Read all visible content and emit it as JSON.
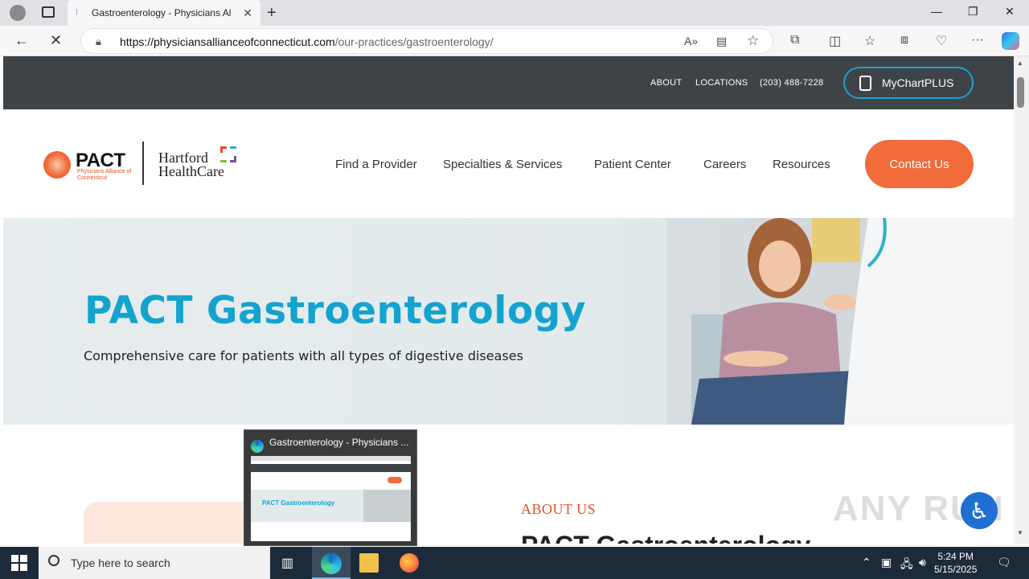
{
  "browser": {
    "tab_title": "Gastroenterology - Physicians Al",
    "url_domain": "https://physiciansallianceofconnecticut.com",
    "url_path": "/our-practices/gastroenterology/"
  },
  "site": {
    "top_links": [
      "ABOUT",
      "LOCATIONS",
      "(203) 488-7228"
    ],
    "mychart_label": "MyChartPLUS",
    "logo_pact": "PACT",
    "logo_sub": "Physicians Alliance of Connecticut",
    "logo_hhc": [
      "Hartford",
      "HealthCare"
    ],
    "nav": [
      "Find a Provider",
      "Specialties & Services",
      "Patient Center",
      "Careers",
      "Resources"
    ],
    "contact_label": "Contact Us",
    "hero_title": "PACT Gastroenterology",
    "hero_subtitle": "Comprehensive care for patients with all types of digestive diseases",
    "about_label": "ABOUT US",
    "about_heading": "PACT Gastroenterology"
  },
  "preview": {
    "title": "Gastroenterology - Physicians ..."
  },
  "watermark": "ANY RUN",
  "taskbar": {
    "search_placeholder": "Type here to search",
    "time": "5:24 PM",
    "date": "5/15/2025"
  },
  "colors": {
    "accent_orange": "#f26b3a",
    "accent_blue": "#14a3cf",
    "topbar": "#3e4348"
  }
}
